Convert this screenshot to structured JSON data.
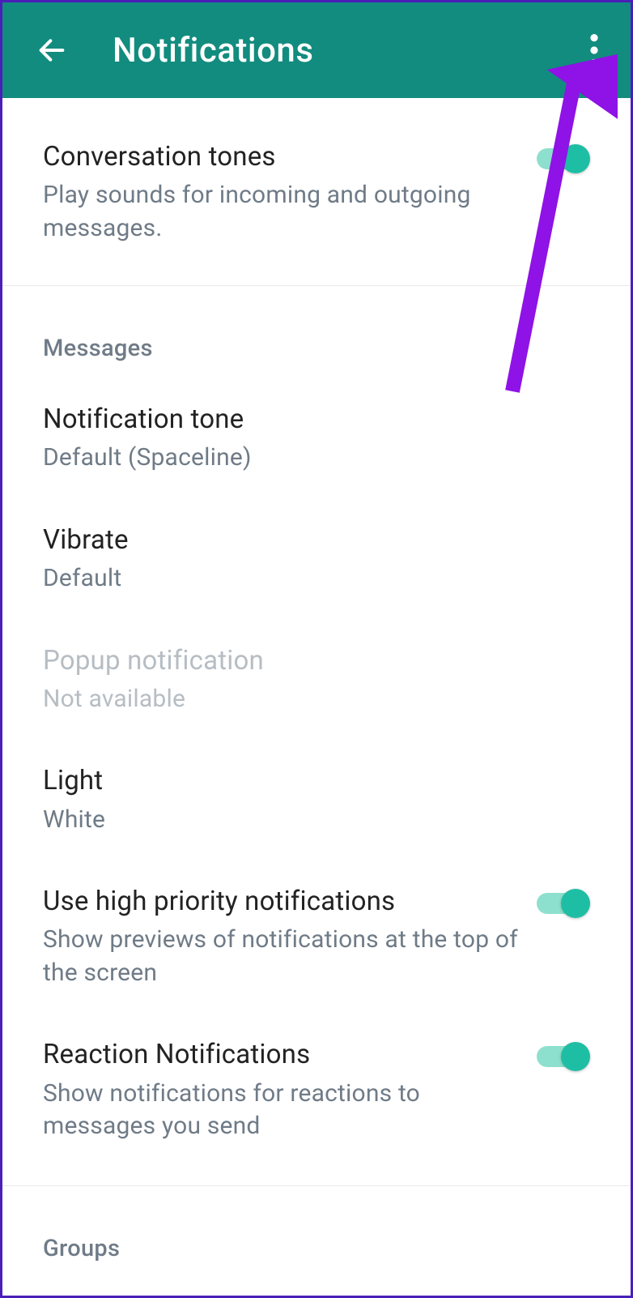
{
  "header": {
    "title": "Notifications"
  },
  "conversation_tones": {
    "title": "Conversation tones",
    "subtitle": "Play sounds for incoming and outgoing messages.",
    "enabled": true
  },
  "sections": {
    "messages_label": "Messages",
    "groups_label": "Groups"
  },
  "messages": {
    "notification_tone": {
      "title": "Notification tone",
      "value": "Default (Spaceline)"
    },
    "vibrate": {
      "title": "Vibrate",
      "value": "Default"
    },
    "popup": {
      "title": "Popup notification",
      "value": "Not available",
      "disabled": true
    },
    "light": {
      "title": "Light",
      "value": "White"
    },
    "high_priority": {
      "title": "Use high priority notifications",
      "subtitle": "Show previews of notifications at the top of the screen",
      "enabled": true
    },
    "reaction": {
      "title": "Reaction Notifications",
      "subtitle": "Show notifications for reactions to messages you send",
      "enabled": true
    }
  },
  "annotation": {
    "arrow_color": "#8f12e6"
  }
}
